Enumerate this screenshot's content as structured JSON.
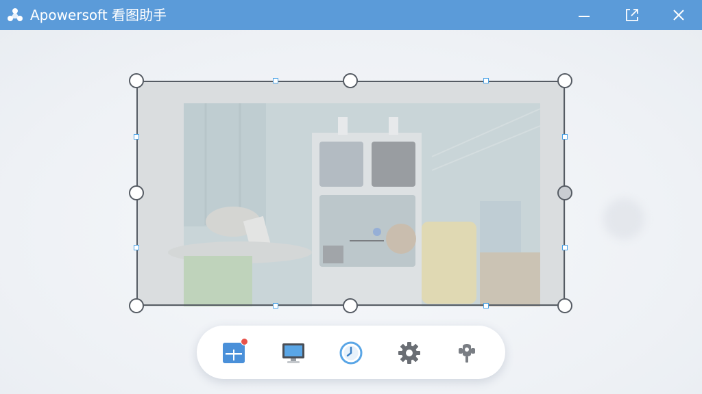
{
  "window": {
    "title": "Apowersoft 看图助手",
    "accent_color": "#5b9bd9",
    "controls": [
      "minimize-icon",
      "popout-icon",
      "close-icon"
    ]
  },
  "capture": {
    "selection_handles": [
      "top-left",
      "top-middle",
      "top-right",
      "middle-left",
      "middle-right",
      "bottom-left",
      "bottom-middle",
      "bottom-right"
    ]
  },
  "toolbar": {
    "items": [
      {
        "icon": "screenshot-edit-icon",
        "has_notification": true,
        "notification_color": "#e8524a"
      },
      {
        "icon": "monitor-icon"
      },
      {
        "icon": "clock-icon"
      },
      {
        "icon": "gear-icon"
      },
      {
        "icon": "pin-icon"
      }
    ]
  }
}
